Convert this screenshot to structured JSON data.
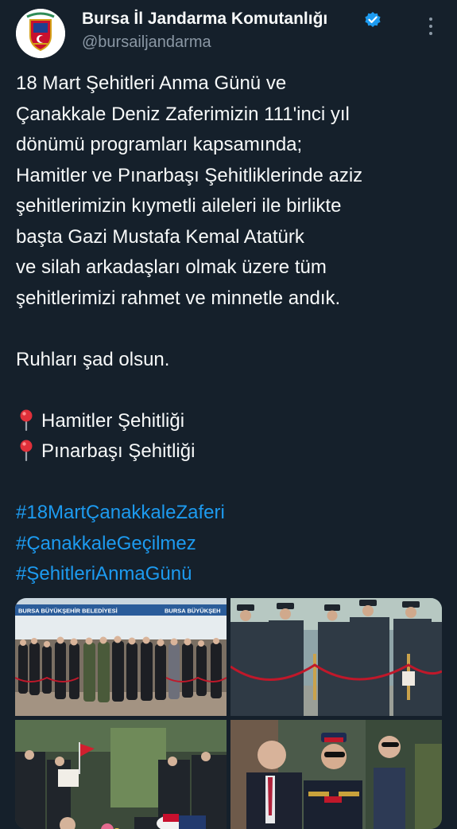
{
  "account": {
    "display_name": "Bursa İl Jandarma Komutanlığı",
    "handle": "@bursailjandarma",
    "avatar_icon": "gendarmerie-emblem-icon",
    "verified_icon": "verified-badge-icon"
  },
  "tweet": {
    "lines": [
      "18 Mart Şehitleri Anma Günü ve",
      "Çanakkale Deniz Zaferimizin 111'inci yıl",
      "dönümü programları kapsamında;",
      "Hamitler ve Pınarbaşı Şehitliklerinde aziz",
      "şehitlerimizin kıymetli aileleri ile birlikte",
      "başta Gazi Mustafa Kemal Atatürk",
      "ve silah arkadaşları olmak üzere tüm",
      "şehitlerimizi rahmet ve minnetle andık."
    ],
    "closing": "Ruhları şad olsun.",
    "locations": [
      "Hamitler Şehitliği",
      "Pınarbaşı Şehitliği"
    ],
    "hashtags": [
      "#18MartÇanakkaleZaferi",
      "#ÇanakkaleGeçilmez",
      "#ŞehitleriAnmaGünü"
    ]
  },
  "media": {
    "photo1_banner": "BURSA BÜYÜKŞEHİR BELEDİYESİ",
    "photo1_banner_right": "BURSA BÜYÜKŞEH"
  },
  "colors": {
    "background": "#15202b",
    "text": "#f7f9f9",
    "secondary": "#8b98a5",
    "link": "#1d9bf0",
    "verified": "#1d9bf0"
  }
}
